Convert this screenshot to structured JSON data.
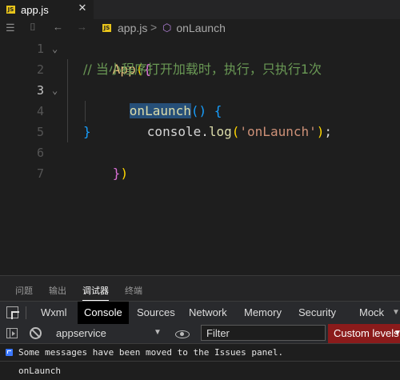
{
  "editor": {
    "tab": {
      "badge": "JS",
      "label": "app.js",
      "close": "✕"
    },
    "breadcrumb": {
      "file_badge": "JS",
      "file": "app.js",
      "separator": ">",
      "symbol": "onLaunch"
    },
    "lines": [
      {
        "n": "1",
        "active": false
      },
      {
        "n": "2",
        "active": false
      },
      {
        "n": "3",
        "active": true
      },
      {
        "n": "4",
        "active": false
      },
      {
        "n": "5",
        "active": false
      },
      {
        "n": "6",
        "active": false
      },
      {
        "n": "7",
        "active": false
      }
    ],
    "code": {
      "l1_fn": "App",
      "l1_paren": "(",
      "l1_brace": "{",
      "l2_comment": "// 当小程序打开加载时，执行，只执行1次",
      "l3_method": "onLaunch",
      "l3_parens": "()",
      "l3_brace": " {",
      "l4_obj": "console.",
      "l4_log": "log",
      "l4_open": "(",
      "l4_str": "'onLaunch'",
      "l4_close": ")",
      "l4_semi": ";",
      "l5_brace": "}",
      "l6_brace": "}",
      "l6_paren": ")"
    }
  },
  "panel": {
    "tabs": [
      "问题",
      "输出",
      "调试器",
      "终端"
    ],
    "active_tab": "调试器"
  },
  "devtools": {
    "tabs": [
      "Wxml",
      "Console",
      "Sources",
      "Network",
      "Memory",
      "Security",
      "Mock"
    ],
    "active_tab": "Console",
    "context": "appservice",
    "filter_placeholder": "Filter",
    "levels_label": "Custom levels",
    "levels_arrow": "▼",
    "context_arrow": "▼"
  },
  "console": {
    "messages": [
      "Some messages have been moved to the Issues panel.",
      "onLaunch"
    ]
  },
  "colors": {
    "accent_selection": "#264f78",
    "levels_background": "#8b1b1b",
    "info_icon": "#3b78ff"
  }
}
